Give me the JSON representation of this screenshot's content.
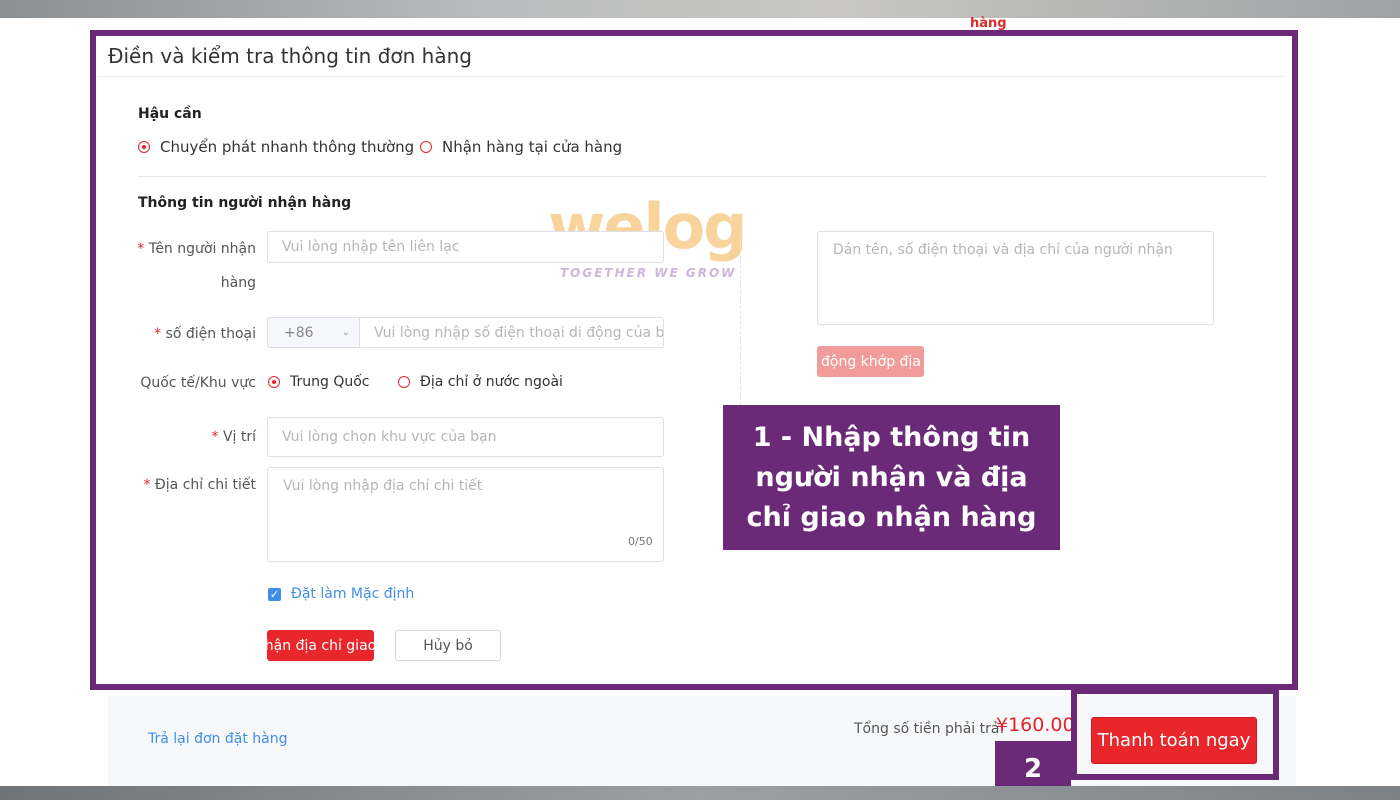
{
  "top_fragment": "hàng",
  "page_title": "Điền và kiểm tra thông tin đơn hàng",
  "logistics": {
    "heading": "Hậu cần",
    "options": [
      {
        "label": "Chuyển phát nhanh thông thường",
        "selected": true
      },
      {
        "label": "Nhận hàng tại cửa hàng",
        "selected": false
      }
    ]
  },
  "recipient": {
    "heading": "Thông tin người nhận hàng",
    "name_label_1": "Tên người nhận",
    "name_label_2": "hàng",
    "name_placeholder": "Vui lòng nhập tên liên lạc",
    "phone_label": "số điện thoại",
    "phone_code": "+86",
    "phone_placeholder": "Vui lòng nhập số điện thoại di động của b",
    "region_label": "Quốc tế/Khu vực",
    "region_options": [
      {
        "label": "Trung Quốc",
        "selected": true
      },
      {
        "label": "Địa chỉ ở nước ngoài",
        "selected": false
      }
    ],
    "location_label": "Vị trí",
    "location_placeholder": "Vui lòng chọn khu vực của bạn",
    "address_label": "Địa chỉ chi tiết",
    "address_placeholder": "Vui lòng nhập địa chỉ chi tiết",
    "address_counter": "0/50",
    "default_label": "Đặt làm Mặc định",
    "confirm_button": "hận địa chỉ giao",
    "cancel_button": "Hủy bỏ",
    "paste_placeholder": "Dán tên, số điện thoại và địa chỉ của người nhận",
    "auto_match_button": "động khớp địa c"
  },
  "watermark": {
    "wordmark": "welog",
    "tagline": "TOGETHER WE GROW"
  },
  "annotations": {
    "step1": "1 - Nhập thông tin người nhận và địa chỉ giao nhận hàng",
    "step2": "2"
  },
  "footer": {
    "back_link": "Trả lại đơn đặt hàng",
    "total_label": "Tổng số tiền phải trả:",
    "total_value": "¥160.00",
    "pay_button": "Thanh toán ngay"
  },
  "colors": {
    "accent": "#e8262b",
    "annotation": "#6b2a78",
    "link": "#3f8ee8"
  }
}
